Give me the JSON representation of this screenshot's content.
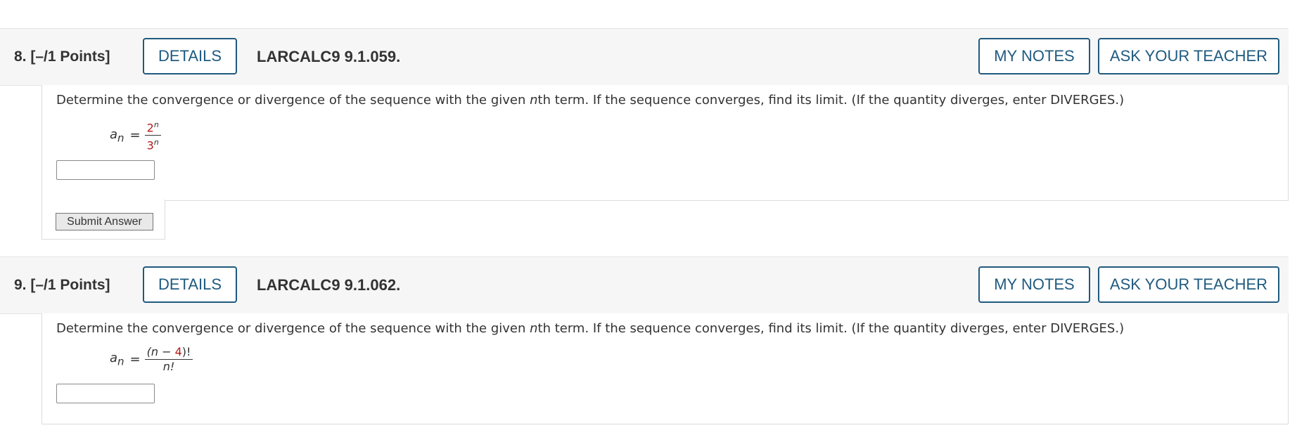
{
  "questions": [
    {
      "number_points": "8.  [–/1 Points]",
      "details_label": "DETAILS",
      "reference": "LARCALC9 9.1.059.",
      "my_notes_label": "MY NOTES",
      "ask_teacher_label": "ASK YOUR TEACHER",
      "prompt_pre": "Determine the convergence or divergence of the sequence with the given ",
      "prompt_var": "n",
      "prompt_post": "th term. If the sequence converges, find its limit. (If the quantity diverges, enter DIVERGES.)",
      "lhs": "a",
      "lhs_sub": "n",
      "eq_sign": "=",
      "numerator_base": "2",
      "numerator_exp": "n",
      "denominator_base": "3",
      "denominator_exp": "n",
      "answer_value": "",
      "submit_label": "Submit Answer"
    },
    {
      "number_points": "9.  [–/1 Points]",
      "details_label": "DETAILS",
      "reference": "LARCALC9 9.1.062.",
      "my_notes_label": "MY NOTES",
      "ask_teacher_label": "ASK YOUR TEACHER",
      "prompt_pre": "Determine the convergence or divergence of the sequence with the given ",
      "prompt_var": "n",
      "prompt_post": "th term. If the sequence converges, find its limit. (If the quantity diverges, enter DIVERGES.)",
      "lhs": "a",
      "lhs_sub": "n",
      "eq_sign": "=",
      "numerator_open": "(n − ",
      "numerator_red": "4",
      "numerator_close": ")!",
      "denominator": "n!",
      "answer_value": ""
    }
  ],
  "colors": {
    "accent": "#1f5a7f",
    "highlight": "#b21a1a",
    "header_bg": "#f6f6f6"
  }
}
